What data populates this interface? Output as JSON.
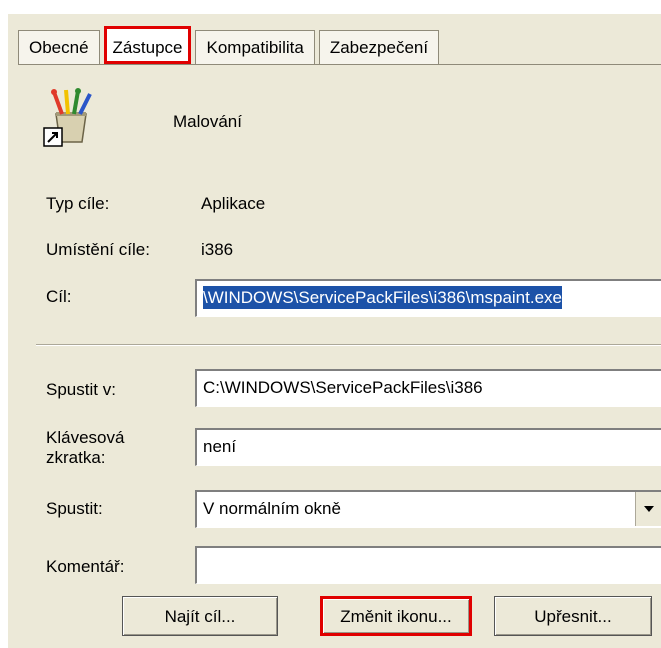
{
  "tabs": [
    {
      "label": "Obecné"
    },
    {
      "label": "Zástupce",
      "active": true
    },
    {
      "label": "Kompatibilita"
    },
    {
      "label": "Zabezpečení"
    }
  ],
  "app": {
    "name": "Malování",
    "icon": "paint-brushes-icon"
  },
  "fields": {
    "target_type": {
      "label": "Typ cíle:",
      "value": "Aplikace"
    },
    "target_location": {
      "label": "Umístění cíle:",
      "value": "i386"
    },
    "target": {
      "label": "Cíl:",
      "value": "\\WINDOWS\\ServicePackFiles\\i386\\mspaint.exe"
    },
    "start_in": {
      "label": "Spustit v:",
      "value": "C:\\WINDOWS\\ServicePackFiles\\i386"
    },
    "shortcut_key": {
      "label_line1": "Klávesová",
      "label_line2": "zkratka:",
      "value": "není"
    },
    "run": {
      "label": "Spustit:",
      "value": "V normálním okně"
    },
    "comment": {
      "label": "Komentář:",
      "value": ""
    }
  },
  "buttons": {
    "find_target": "Najít cíl...",
    "change_icon": "Změnit ikonu...",
    "advanced": "Upřesnit..."
  },
  "colors": {
    "highlight_red": "#e00000",
    "selection_blue": "#1c52a8",
    "dialog_bg": "#ece9d8"
  }
}
